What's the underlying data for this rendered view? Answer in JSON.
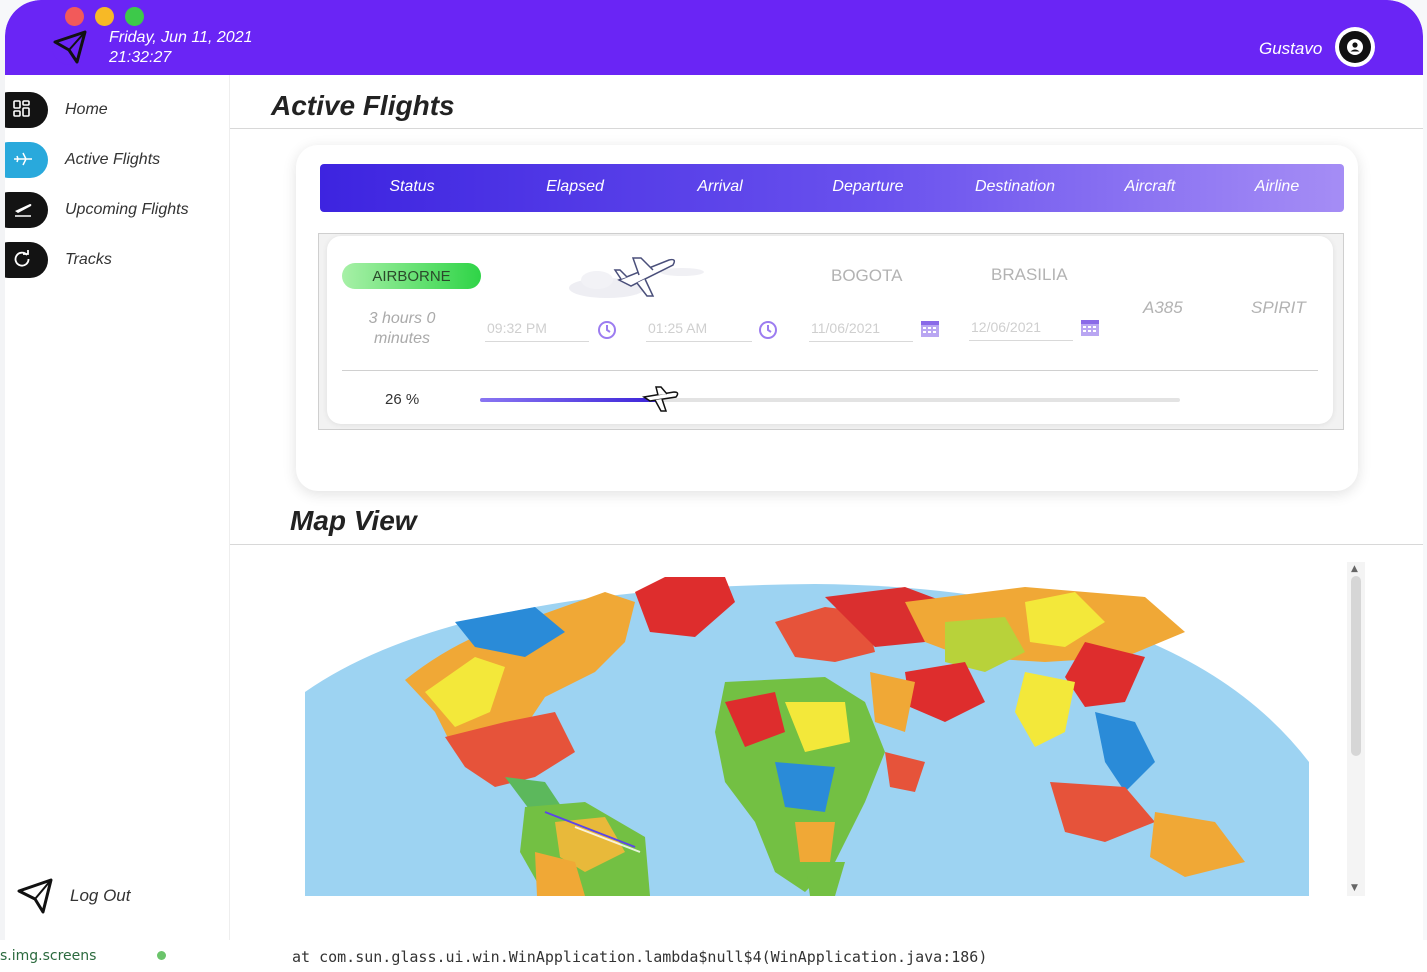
{
  "header": {
    "date": "Friday, Jun 11, 2021",
    "time": "21:32:27",
    "username": "Gustavo"
  },
  "sidebar": {
    "items": [
      {
        "label": "Home",
        "icon": "dashboard-icon"
      },
      {
        "label": "Active Flights",
        "icon": "plane-icon",
        "active": true
      },
      {
        "label": "Upcoming Flights",
        "icon": "takeoff-icon"
      },
      {
        "label": "Tracks",
        "icon": "refresh-icon"
      }
    ],
    "logout_label": "Log Out"
  },
  "active_flights": {
    "title": "Active Flights",
    "columns": [
      "Status",
      "Elapsed",
      "Arrival",
      "Departure",
      "Destination",
      "Aircraft",
      "Airline"
    ],
    "flight": {
      "status": "AIRBORNE",
      "elapsed": "3 hours 0 minutes",
      "arrival_time": "09:32 PM",
      "departure_time": "01:25 AM",
      "departure_city": "BOGOTA",
      "destination_city": "BRASILIA",
      "departure_date": "11/06/2021",
      "arrival_date": "12/06/2021",
      "aircraft": "A385",
      "airline": "SPIRIT",
      "progress_label": "26 %",
      "progress": 0.26
    }
  },
  "map_view": {
    "title": "Map View"
  },
  "background": {
    "ide_path": "s.img.screens",
    "log_line": "at com.sun.glass.ui.win.WinApplication.lambda$null$4(WinApplication.java:186)"
  },
  "colors": {
    "topbar": "#6a25f5",
    "active_nav": "#29a9dc",
    "status_green": "#2fd447",
    "accent_purple": "#3d24e0"
  }
}
